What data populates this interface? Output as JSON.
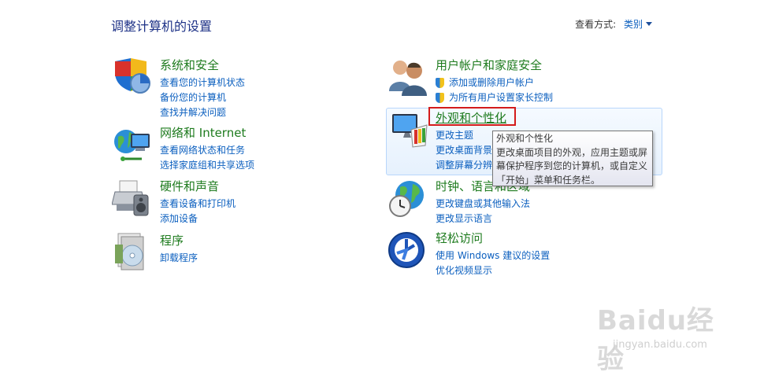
{
  "header": {
    "page_title": "调整计算机的设置",
    "view_by_label": "查看方式:",
    "view_by_value": "类别"
  },
  "categories": {
    "system": {
      "title": "系统和安全",
      "icon": "shield-pie-icon",
      "links": [
        "查看您的计算机状态",
        "备份您的计算机",
        "查找并解决问题"
      ]
    },
    "network": {
      "title": "网络和 Internet",
      "icon": "network-globe-icon",
      "links": [
        "查看网络状态和任务",
        "选择家庭组和共享选项"
      ]
    },
    "hardware": {
      "title": "硬件和声音",
      "icon": "printer-speaker-icon",
      "links": [
        "查看设备和打印机",
        "添加设备"
      ]
    },
    "programs": {
      "title": "程序",
      "icon": "programs-disc-icon",
      "links": [
        "卸载程序"
      ]
    },
    "users": {
      "title": "用户帐户和家庭安全",
      "icon": "users-icon",
      "links": [
        "添加或删除用户帐户",
        "为所有用户设置家长控制"
      ]
    },
    "appearance": {
      "title": "外观和个性化",
      "icon": "monitor-palette-icon",
      "links": [
        "更改主题",
        "更改桌面背景",
        "调整屏幕分辨率"
      ]
    },
    "clock": {
      "title": "时钟、语言和区域",
      "icon": "globe-clock-icon",
      "links": [
        "更改键盘或其他输入法",
        "更改显示语言"
      ]
    },
    "ease": {
      "title": "轻松访问",
      "icon": "ease-of-access-icon",
      "links": [
        "使用 Windows 建议的设置",
        "优化视频显示"
      ]
    }
  },
  "tooltip": {
    "title": "外观和个性化",
    "line1": "更改桌面项目的外观，应用主题或屏",
    "line2": "幕保护程序到您的计算机，或自定义",
    "line3": "「开始」菜单和任务栏。"
  },
  "watermark": {
    "brand": "Baidu经验",
    "sub": "jingyan.baidu.com"
  },
  "colors": {
    "title_green": "#1e7b1e",
    "link_blue": "#0b5fbf",
    "highlight_red": "#d41b1b"
  }
}
